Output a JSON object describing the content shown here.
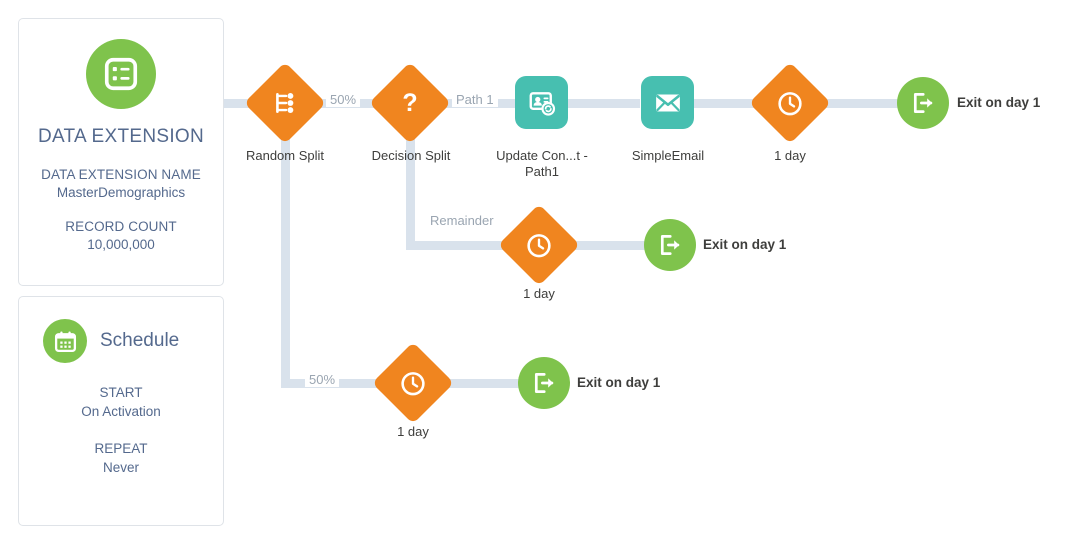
{
  "data_extension_card": {
    "icon": "data-extension-list-icon",
    "title": "DATA EXTENSION",
    "name_label": "DATA EXTENSION NAME",
    "name_value": "MasterDemographics",
    "count_label": "RECORD COUNT",
    "count_value": "10,000,000"
  },
  "schedule_card": {
    "icon": "calendar-icon",
    "title": "Schedule",
    "start_label": "START",
    "start_value": "On Activation",
    "repeat_label": "REPEAT",
    "repeat_value": "Never"
  },
  "nodes": {
    "random_split": {
      "label": "Random Split",
      "icon": "random-split-icon",
      "shape": "diamond",
      "color": "#F0851F"
    },
    "decision_split": {
      "label": "Decision Split",
      "icon": "question-mark-icon",
      "shape": "diamond",
      "color": "#F0851F"
    },
    "update_contact": {
      "label": "Update Con...t - Path1",
      "icon": "update-contact-icon",
      "shape": "rounded-square",
      "color": "#47BFB0"
    },
    "simple_email": {
      "label": "SimpleEmail",
      "icon": "envelope-icon",
      "shape": "rounded-square",
      "color": "#47BFB0"
    },
    "wait_top": {
      "label": "1 day",
      "icon": "clock-icon",
      "shape": "diamond",
      "color": "#F0851F"
    },
    "exit_top": {
      "label": "Exit on day 1",
      "icon": "exit-arrow-icon",
      "shape": "circle",
      "color": "#7FC34C"
    },
    "wait_middle": {
      "label": "1 day",
      "icon": "clock-icon",
      "shape": "diamond",
      "color": "#F0851F"
    },
    "exit_middle": {
      "label": "Exit on day 1",
      "icon": "exit-arrow-icon",
      "shape": "circle",
      "color": "#7FC34C"
    },
    "wait_bottom": {
      "label": "1 day",
      "icon": "clock-icon",
      "shape": "diamond",
      "color": "#F0851F"
    },
    "exit_bottom": {
      "label": "Exit on day 1",
      "icon": "exit-arrow-icon",
      "shape": "circle",
      "color": "#7FC34C"
    }
  },
  "connector_labels": {
    "random_split_path_a": "50%",
    "random_split_path_b": "50%",
    "decision_path_1": "Path 1",
    "decision_remainder": "Remainder"
  },
  "colors": {
    "orange": "#F0851F",
    "green": "#7FC34C",
    "teal": "#47BFB0",
    "connector": "#D9E2EC",
    "slate_text": "#54698D",
    "label_text": "#3E3E3C",
    "muted_text": "#9AA5B1"
  }
}
